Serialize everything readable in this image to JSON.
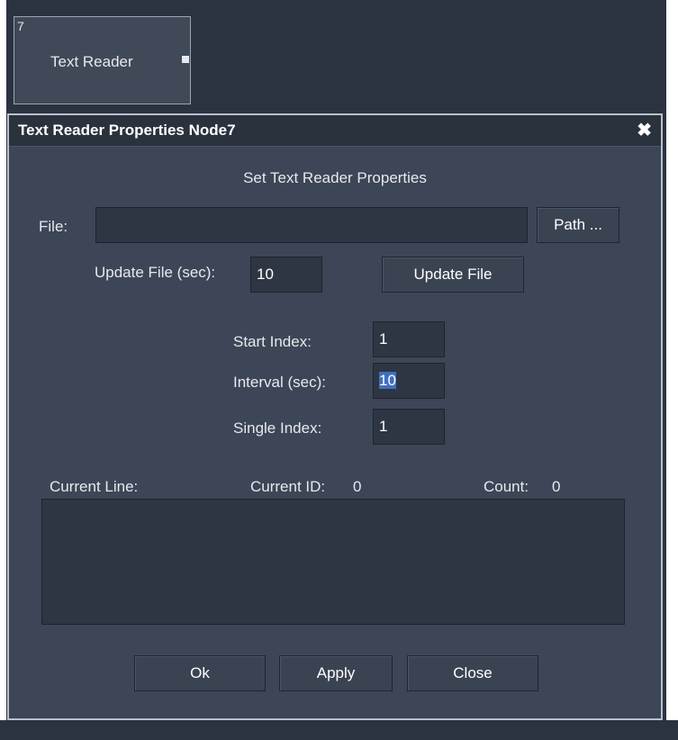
{
  "node": {
    "id": "7",
    "title": "Text Reader"
  },
  "dialog": {
    "title": "Text Reader Properties Node7",
    "close_glyph": "✖",
    "heading": "Set Text Reader Properties",
    "file": {
      "label": "File:",
      "value": "",
      "path_button": "Path ..."
    },
    "update": {
      "label": "Update File (sec):",
      "value": "10",
      "button": "Update File"
    },
    "start_index": {
      "label": "Start Index:",
      "value": "1"
    },
    "interval": {
      "label": "Interval (sec):",
      "value": "10"
    },
    "single_index": {
      "label": "Single Index:",
      "value": "1"
    },
    "status": {
      "current_line_label": "Current Line:",
      "current_id_label": "Current ID:",
      "current_id_value": "0",
      "count_label": "Count:",
      "count_value": "0"
    },
    "current_line_text": "",
    "buttons": {
      "ok": "Ok",
      "apply": "Apply",
      "close": "Close"
    }
  },
  "colors": {
    "background": "#2b3340",
    "dialog_bg": "#3d4656",
    "field_bg": "#2e3644",
    "selection": "#3f6fbf"
  }
}
